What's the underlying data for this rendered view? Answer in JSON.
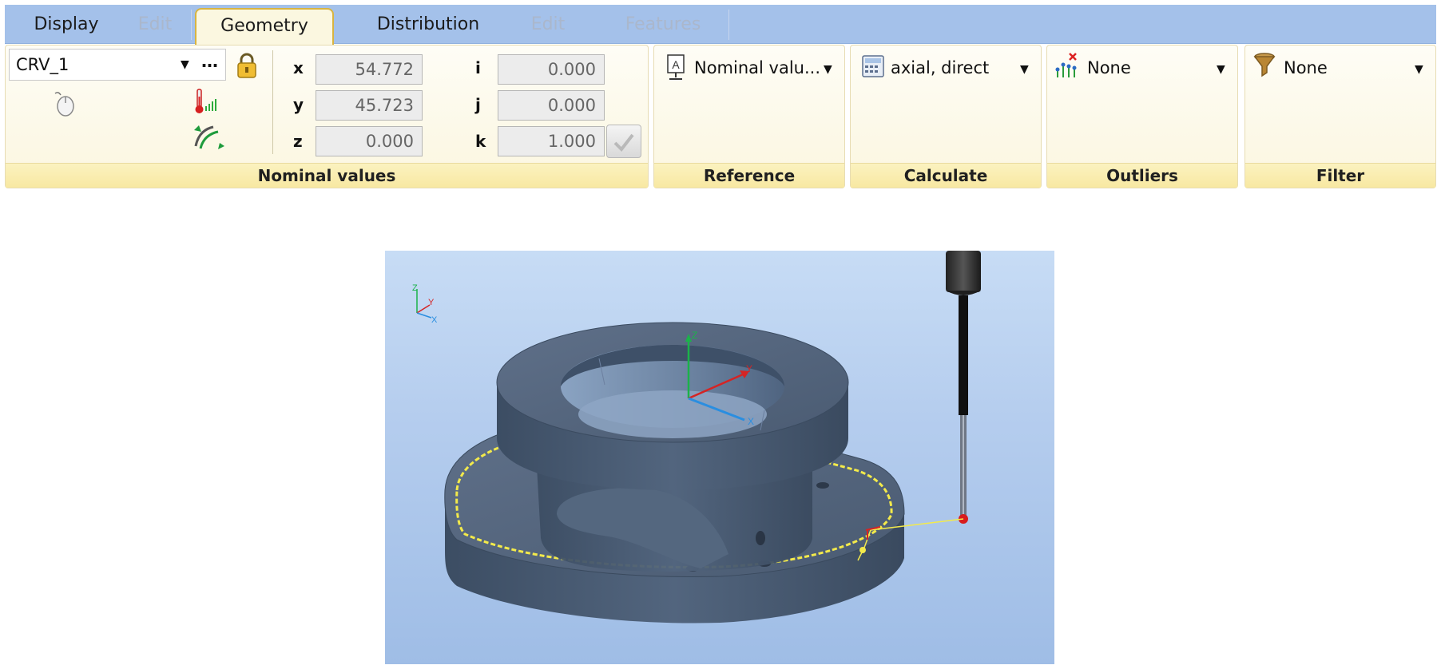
{
  "tabs": [
    {
      "label": "Display",
      "state": "normal"
    },
    {
      "label": "Edit",
      "state": "disabled"
    },
    {
      "label": "Geometry",
      "state": "active"
    },
    {
      "label": "Distribution",
      "state": "normal"
    },
    {
      "label": "Edit",
      "state": "disabled"
    },
    {
      "label": "Features",
      "state": "disabled"
    }
  ],
  "nominal": {
    "element": "CRV_1",
    "more": "…",
    "x_label": "x",
    "y_label": "y",
    "z_label": "z",
    "i_label": "i",
    "j_label": "j",
    "k_label": "k",
    "x": "54.772",
    "y": "45.723",
    "z": "0.000",
    "i": "0.000",
    "j": "0.000",
    "k": "1.000",
    "group_label": "Nominal values",
    "icons": [
      "lock-icon",
      "mouse-icon",
      "thermometer-icon",
      "curve-icon",
      "check-icon"
    ]
  },
  "reference": {
    "value": "Nominal valu...",
    "group_label": "Reference",
    "icon": "reference-icon"
  },
  "calculate": {
    "value": "axial, direct",
    "group_label": "Calculate",
    "icon": "calculator-icon"
  },
  "outliers": {
    "value": "None",
    "group_label": "Outliers",
    "icon": "outliers-icon"
  },
  "filter": {
    "value": "None",
    "group_label": "Filter",
    "icon": "funnel-icon"
  },
  "viewport": {
    "triad": {
      "z": "Z",
      "y": "Y",
      "x": "X"
    },
    "part_axes": {
      "z": "Z",
      "y": "Y",
      "x": "X"
    }
  },
  "colors": {
    "tabbar": "#a4c1ea",
    "ribbon_label": "#f8e8a2",
    "part": "#4d5e74",
    "scan_path": "#f3ea4b",
    "probe_tip": "#d81c1c",
    "axis_x": "#2a8ee0",
    "axis_y": "#d52424",
    "axis_z": "#1bb24a"
  }
}
